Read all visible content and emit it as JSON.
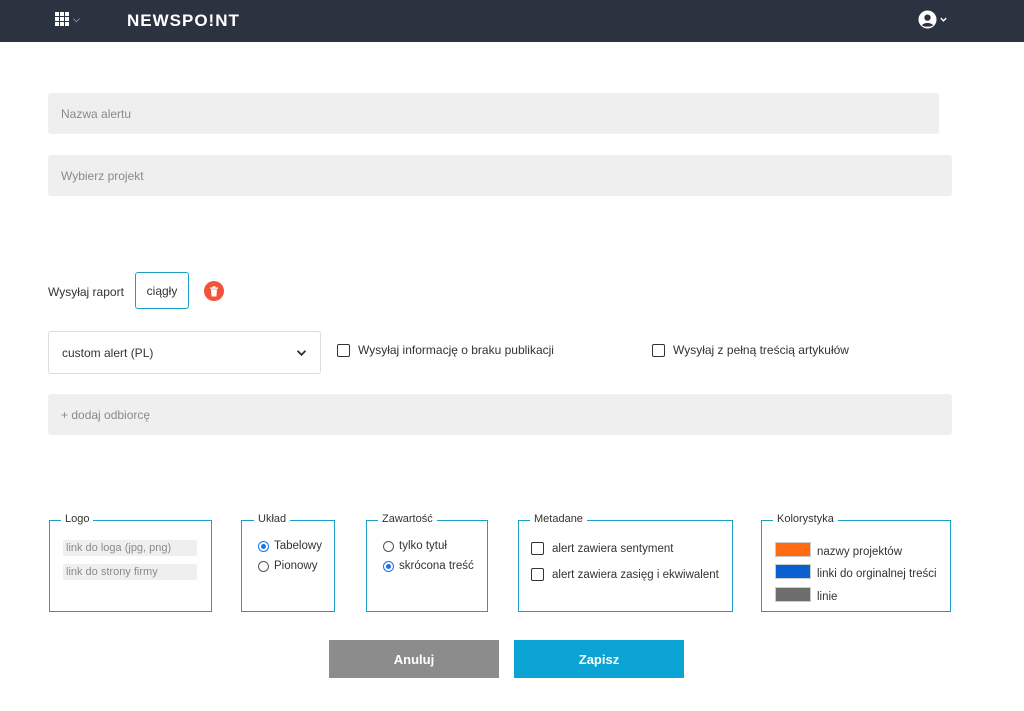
{
  "header": {
    "brand": "NEWSPO!NT",
    "apps_icon": "grid-icon",
    "user_icon": "user-circle-icon"
  },
  "form": {
    "alert_name_placeholder": "Nazwa alertu",
    "project_placeholder": "Wybierz projekt",
    "send_report_label": "Wysyłaj raport",
    "report_tag": "ciągły",
    "template_select_value": "custom alert (PL)",
    "no_publication_label": "Wysyłaj informację o braku publikacji",
    "full_content_label": "Wysyłaj z pełną treścią artykułów",
    "add_recipient_placeholder": "+ dodaj odbiorcę"
  },
  "groups": {
    "logo": {
      "title": "Logo",
      "logo_link_placeholder": "link do loga (jpg, png)",
      "company_link_placeholder": "link do strony firmy"
    },
    "layout": {
      "title": "Układ",
      "options": [
        "Tabelowy",
        "Pionowy"
      ],
      "selected": "Tabelowy"
    },
    "content": {
      "title": "Zawartość",
      "options": [
        "tylko tytuł",
        "skrócona treść"
      ],
      "selected": "skrócona treść"
    },
    "metadata": {
      "title": "Metadane",
      "options": [
        "alert zawiera sentyment",
        "alert zawiera zasięg i ekwiwalent"
      ]
    },
    "colors": {
      "title": "Kolorystyka",
      "items": [
        {
          "label": "nazwy projektów",
          "color": "#ff6a13"
        },
        {
          "label": "linki do orginalnej treści",
          "color": "#0a5fd1"
        },
        {
          "label": "linie",
          "color": "#6d6d6d"
        }
      ]
    }
  },
  "buttons": {
    "cancel": "Anuluj",
    "save": "Zapisz",
    "cancel_color": "#8c8c8c",
    "save_color": "#0aa3d4"
  },
  "colors": {
    "header_bg": "#2b3240",
    "accent": "#1aa0c8",
    "delete": "#f2533a"
  }
}
